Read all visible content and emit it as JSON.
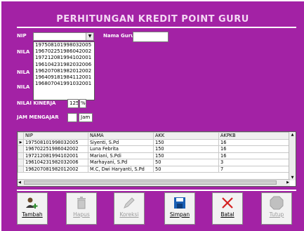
{
  "title": "PERHITUNGAN KREDIT POINT GURU",
  "labels": {
    "nip": "NIP",
    "nama_guru": "Nama Guru",
    "nilai_1": "NILA",
    "nilai_2": "NILA",
    "nilai_3": "NILA",
    "nilai_kinerja": "NILAI KINERJA",
    "percent": "%",
    "jam_mengajar": "JAM MENGAJAR",
    "jam_unit": "Jam"
  },
  "fields": {
    "nip_value": "",
    "nama_guru_value": "",
    "nilai_kinerja_value": "125",
    "jam_value": ""
  },
  "dropdown_options": [
    "197508101998032005",
    "196702251986042002",
    "197212081994102001",
    "196104231982032006",
    "196207081982012002",
    "196409181984112001",
    "196807041991032001"
  ],
  "grid": {
    "columns": [
      "NIP",
      "NAMA",
      "AKK",
      "AKPKB"
    ],
    "rows": [
      [
        "197508101998032005",
        "Siyenti, S.Pd",
        "150",
        "16"
      ],
      [
        "196702251986042002",
        "Luna Febrita",
        "150",
        "16"
      ],
      [
        "197212081994102001",
        "Mariani, S.Pdi",
        "150",
        "16"
      ],
      [
        "196104231982032006",
        "Marhayani, S.Pd",
        "50",
        "3"
      ],
      [
        "196207081982012002",
        "M.C, Dwi Haryanti, S.Pd",
        "50",
        "7"
      ]
    ],
    "current_row_marker": "▶"
  },
  "buttons": [
    {
      "label": "Tambah",
      "icon": "add-user-icon",
      "enabled": true
    },
    {
      "label": "Hapus",
      "icon": "trash-icon",
      "enabled": false
    },
    {
      "label": "Koreksi",
      "icon": "edit-icon",
      "enabled": false
    },
    {
      "label": "Simpan",
      "icon": "save-disk-icon",
      "enabled": true
    },
    {
      "label": "Batal",
      "icon": "cancel-x-icon",
      "enabled": true
    },
    {
      "label": "Tutup",
      "icon": "stop-sign-icon",
      "enabled": false
    }
  ],
  "colors": {
    "form_bg": "#a322a5",
    "title_text": "#f4d8f4",
    "cancel_red": "#d42020",
    "save_blue": "#1a5fb4"
  }
}
